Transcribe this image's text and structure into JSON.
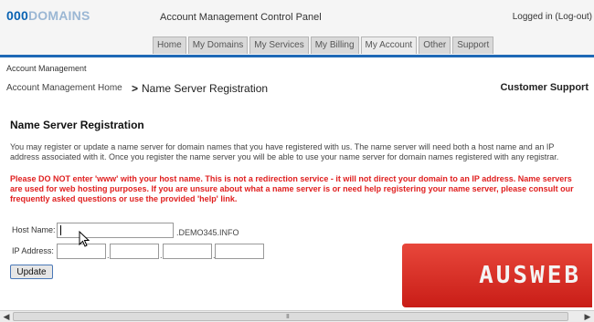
{
  "header": {
    "logo_part1": "000",
    "logo_part2": "DOMAINS",
    "panel_title": "Account Management Control Panel",
    "login_text": "Logged in (Log-out)"
  },
  "tabs": [
    {
      "label": "Home"
    },
    {
      "label": "My Domains"
    },
    {
      "label": "My Services"
    },
    {
      "label": "My Billing"
    },
    {
      "label": "My Account"
    },
    {
      "label": "Other"
    },
    {
      "label": "Support"
    }
  ],
  "breadcrumb": {
    "small": "Account Management",
    "home": "Account Management Home",
    "separator": ">",
    "current": "Name Server Registration",
    "support": "Customer Support"
  },
  "main": {
    "title": "Name Server Registration",
    "intro": "You may register or update a name server for domain names that you have registered with us. The name server will need both a host name and an IP address associated with it. Once you register the name server you will be able to use your name server for domain names registered with any registrar.",
    "warning": "Please DO NOT enter 'www' with your host name. This is not a redirection service - it will not direct your domain to an IP address. Name servers are used for web hosting purposes. If you are unsure about what a name server is or need help registering your name server, please consult our frequently asked questions or use the provided 'help' link."
  },
  "form": {
    "host_label": "Host Name:",
    "host_value": "",
    "domain_suffix": ".DEMO345.INFO",
    "ip_label": "IP Address:",
    "ip_octets": [
      "",
      "",
      "",
      ""
    ],
    "ip_separator": ".",
    "update_label": "Update"
  },
  "watermark": {
    "text": "AUSWEB"
  },
  "scrollbar": {
    "left_icon": "chevron-left-icon",
    "right_icon": "chevron-right-icon",
    "grip": "III"
  },
  "colors": {
    "brand_blue": "#0a63b3",
    "warning_red": "#e02020",
    "watermark_red": "#d62a22"
  }
}
